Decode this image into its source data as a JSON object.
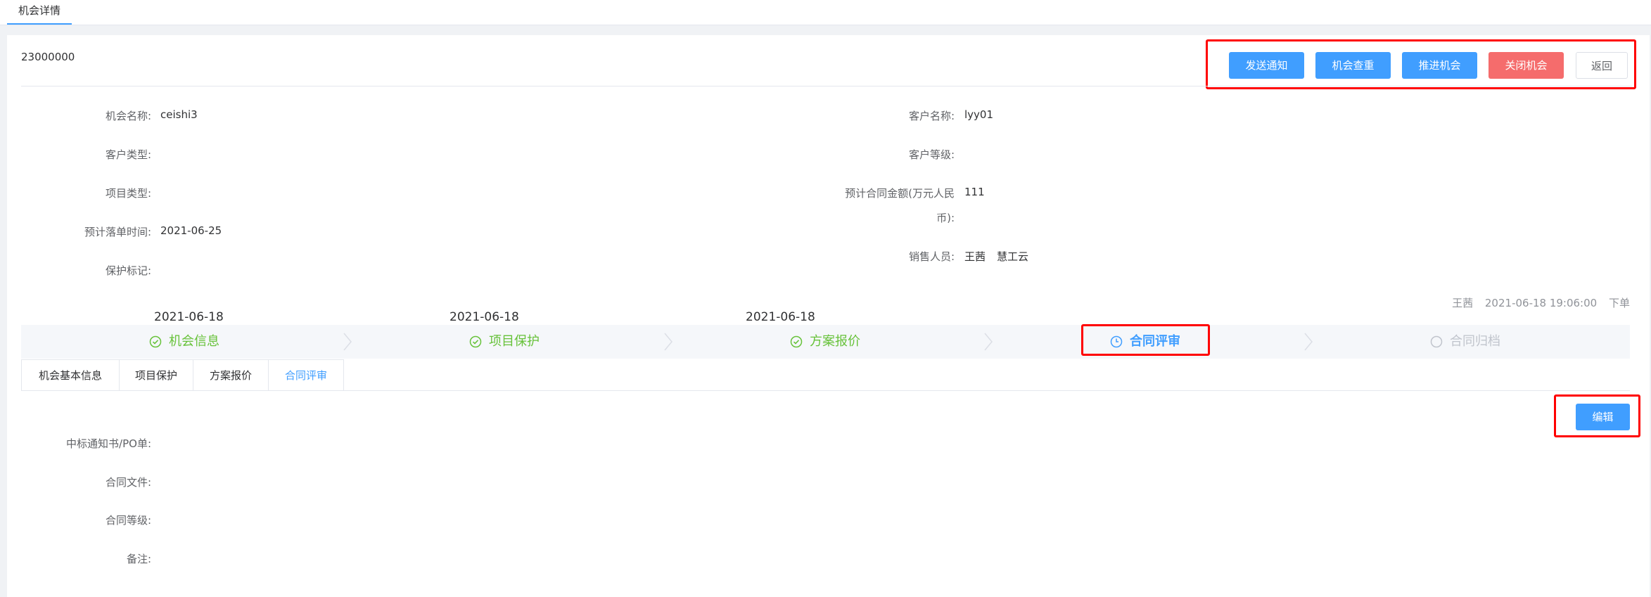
{
  "top_tab": {
    "label": "机会详情"
  },
  "header": {
    "opportunity_id": "23000000",
    "buttons": {
      "send_notice": "发送通知",
      "check_duplicate": "机会查重",
      "advance": "推进机会",
      "close": "关闭机会",
      "back": "返回"
    }
  },
  "info": {
    "opportunity_name_label": "机会名称:",
    "opportunity_name": "ceishi3",
    "customer_type_label": "客户类型:",
    "customer_type": "",
    "project_type_label": "项目类型:",
    "project_type": "",
    "expected_close_label": "预计落单时间:",
    "expected_close": "2021-06-25",
    "protection_mark_label": "保护标记:",
    "protection_mark": "",
    "customer_name_label": "客户名称:",
    "customer_name": "lyy01",
    "customer_level_label": "客户等级:",
    "customer_level": "",
    "contract_amount_label_line1": "预计合同金额(万元人民",
    "contract_amount_label_line2": "币):",
    "contract_amount": "111",
    "sales_label": "销售人员:",
    "sales_person_1": "王茜",
    "sales_person_2": "慧工云"
  },
  "meta": {
    "user": "王茜",
    "timestamp": "2021-06-18 19:06:00",
    "action": "下单"
  },
  "steps": [
    {
      "label": "机会信息",
      "date": "2021-06-18",
      "status": "done"
    },
    {
      "label": "项目保护",
      "date": "2021-06-18",
      "status": "done"
    },
    {
      "label": "方案报价",
      "date": "2021-06-18",
      "status": "done"
    },
    {
      "label": "合同评审",
      "date": "",
      "status": "active"
    },
    {
      "label": "合同归档",
      "date": "",
      "status": "pending"
    }
  ],
  "sub_tabs": [
    "机会基本信息",
    "项目保护",
    "方案报价",
    "合同评审"
  ],
  "contract_review": {
    "edit_button": "编辑",
    "award_notice_label": "中标通知书/PO单:",
    "contract_file_label": "合同文件:",
    "contract_level_label": "合同等级:",
    "remarks_label": "备注:"
  },
  "colors": {
    "primary": "#409eff",
    "danger": "#f56c6c",
    "success": "#67c23a",
    "highlight_box": "#ff0000"
  }
}
